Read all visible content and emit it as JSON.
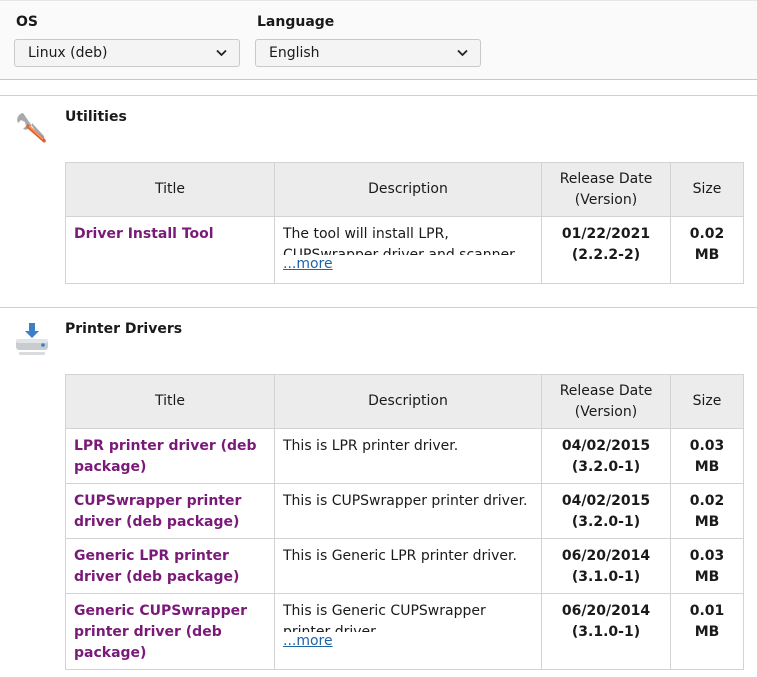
{
  "filters": {
    "os": {
      "label": "OS",
      "value": "Linux (deb)"
    },
    "language": {
      "label": "Language",
      "value": "English"
    }
  },
  "columns": {
    "title": "Title",
    "description": "Description",
    "release": "Release Date (Version)",
    "size": "Size"
  },
  "more_label": "...more",
  "sections": {
    "utilities": {
      "title": "Utilities",
      "rows": [
        {
          "title": "Driver Install Tool",
          "description": "The tool will install LPR, CUPSwrapper driver and scanner",
          "date": "01/22/2021",
          "version": "(2.2.2-2)",
          "size": "0.02 MB"
        }
      ]
    },
    "printer_drivers": {
      "title": "Printer Drivers",
      "rows": [
        {
          "title": "LPR printer driver (deb package)",
          "description": "This is LPR printer driver.",
          "date": "04/02/2015",
          "version": "(3.2.0-1)",
          "size": "0.03 MB"
        },
        {
          "title": "CUPSwrapper printer driver (deb package)",
          "description": "This is CUPSwrapper printer driver.",
          "date": "04/02/2015",
          "version": "(3.2.0-1)",
          "size": "0.02 MB"
        },
        {
          "title": "Generic LPR printer driver (deb package)",
          "description": "This is Generic LPR printer driver.",
          "date": "06/20/2014",
          "version": "(3.1.0-1)",
          "size": "0.03 MB"
        },
        {
          "title": "Generic CUPSwrapper printer driver (deb package)",
          "description": "This is Generic CUPSwrapper printer driver",
          "date": "06/20/2014",
          "version": "(3.1.0-1)",
          "size": "0.01 MB"
        }
      ]
    }
  },
  "icons": {
    "utilities": "wrench-icon",
    "printer_drivers": "download-printer-icon",
    "dropdown": "chevron-down-icon"
  },
  "colors": {
    "link": "#7a1a78",
    "more": "#1e64a8",
    "header_bg": "#ececec"
  }
}
